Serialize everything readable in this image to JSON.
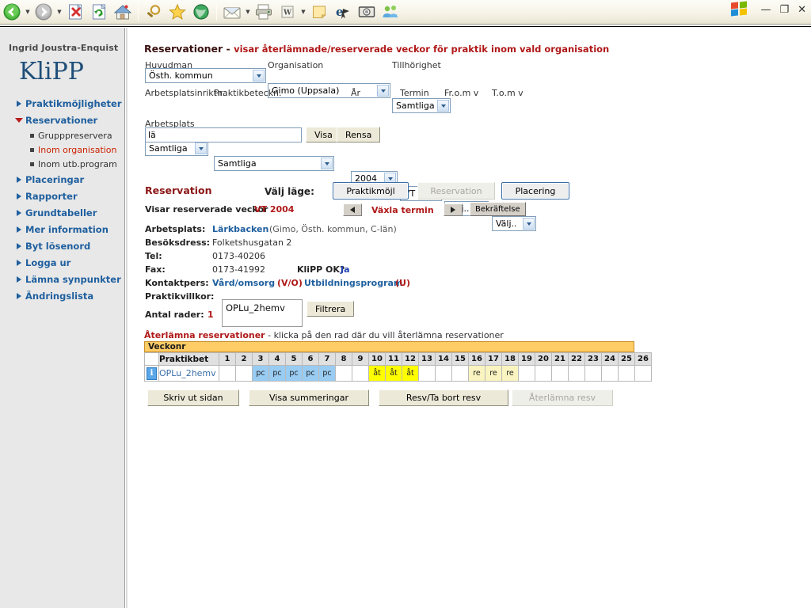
{
  "browser": {
    "toolbar_icons": [
      {
        "name": "back-icon",
        "glyph": "◀"
      },
      {
        "name": "back-dropdown-caret",
        "glyph": "▼"
      },
      {
        "name": "forward-icon",
        "glyph": "▶"
      },
      {
        "name": "forward-dropdown-caret",
        "glyph": "▼"
      },
      {
        "name": "stop-icon",
        "glyph": "✖"
      },
      {
        "name": "refresh-icon",
        "glyph": "⟳"
      },
      {
        "name": "home-icon",
        "glyph": "⌂"
      },
      {
        "name": "search-icon",
        "glyph": "🔍"
      },
      {
        "name": "favorites-star-icon",
        "glyph": "★"
      },
      {
        "name": "history-icon",
        "glyph": "🕘"
      },
      {
        "name": "mail-icon",
        "glyph": "✉"
      },
      {
        "name": "mail-dropdown-caret",
        "glyph": "▼"
      },
      {
        "name": "print-icon",
        "glyph": "🖨"
      },
      {
        "name": "edit-word-icon",
        "glyph": "W"
      },
      {
        "name": "edit-dropdown-caret",
        "glyph": "▼"
      },
      {
        "name": "notes-icon",
        "glyph": "▭"
      },
      {
        "name": "messenger-e-icon",
        "glyph": "e"
      },
      {
        "name": "camera-icon",
        "glyph": "▣"
      },
      {
        "name": "people-icon",
        "glyph": "👥"
      }
    ],
    "window_controls": {
      "minimize": "—",
      "restore": "❐",
      "close": "✕"
    }
  },
  "sidebar": {
    "user": "Ingrid Joustra-Enquist",
    "brand": "KliPP",
    "items": [
      {
        "label": "Praktikmöjligheter",
        "state": "collapsed"
      },
      {
        "label": "Reservationer",
        "state": "expanded"
      },
      {
        "label": "Placeringar",
        "state": "collapsed"
      },
      {
        "label": "Rapporter",
        "state": "collapsed"
      },
      {
        "label": "Grundtabeller",
        "state": "collapsed"
      },
      {
        "label": "Mer information",
        "state": "collapsed"
      },
      {
        "label": "Byt lösenord",
        "state": "collapsed"
      },
      {
        "label": "Logga ur",
        "state": "collapsed"
      },
      {
        "label": "Lämna synpunkter",
        "state": "collapsed"
      },
      {
        "label": "Ändringslista",
        "state": "collapsed"
      }
    ],
    "subitems": [
      {
        "label": "Grupppreservera",
        "active": false
      },
      {
        "label": "Inom organisation",
        "active": true
      },
      {
        "label": "Inom utb.program",
        "active": false
      }
    ]
  },
  "page": {
    "title": "Reservationer",
    "title_separator": " - ",
    "subtitle": "visar återlämnade/reserverade veckor för praktik inom vald organisation"
  },
  "filters": {
    "huvudman": {
      "label": "Huvudman",
      "value": "Östh. kommun"
    },
    "organisation": {
      "label": "Organisation",
      "value": "Gimo (Uppsala)"
    },
    "tillhorighet": {
      "label": "Tillhörighet",
      "value": "Samtliga"
    },
    "arbetsplatsinriktn": {
      "label": "Arbetsplatsinriktn.",
      "value": "Samtliga"
    },
    "praktikbeteckn": {
      "label": "Praktikbeteckn.",
      "value": "Samtliga"
    },
    "ar": {
      "label": "År",
      "value": "2004"
    },
    "termin": {
      "label": "Termin",
      "value": "VT"
    },
    "fr_o_m_v": {
      "label": "Fr.o.m v",
      "value": "Välj.."
    },
    "t_o_m_v": {
      "label": "T.o.m v",
      "value": "Välj.."
    },
    "arbetsplats": {
      "label": "Arbetsplats",
      "value": "lä",
      "placeholder": ""
    },
    "visa_button": "Visa",
    "rensa_button": "Rensa"
  },
  "reservation": {
    "heading": "Reservation",
    "mode_label": "Välj läge:",
    "mode_buttons": [
      {
        "label": "Praktikmöjl",
        "state": "active"
      },
      {
        "label": "Reservation",
        "state": "disabled"
      },
      {
        "label": "Placering",
        "state": "active"
      }
    ],
    "showing_label": "Visar reserverade veckor",
    "showing_value": "VT 2004",
    "term_switch_label": "Växla termin",
    "prev_arrow": "◀",
    "next_arrow": "▶",
    "confirm_button": "Bekräftelse",
    "details": [
      {
        "label": "Arbetsplats:",
        "value": "Lärkbacken",
        "extra": "(Gimo, Östh. kommun, C-län)"
      },
      {
        "label": "Besöksdress:",
        "value": "Folketshusgatan 2",
        "extra": ""
      },
      {
        "label": "Tel:",
        "value": "0173-40206",
        "extra": ""
      },
      {
        "label": "Fax:",
        "value": "0173-41992",
        "extra": ""
      },
      {
        "label": "Kontaktpers:",
        "value": "",
        "extra": ""
      },
      {
        "label": "Praktikvillkor:",
        "value": "",
        "extra": ""
      }
    ],
    "klipp_ok_label": "KliPP OK?",
    "klipp_ok_value": "Ja",
    "contact_1_name": "Vård/omsorg",
    "contact_1_code": "(V/O)",
    "contact_2_name": "Utbildningsprogram",
    "contact_2_code": "(U)",
    "antal_rader_label": "Antal rader:",
    "antal_rader_value": "1",
    "filter_textarea_value": "OPLu_2hemv",
    "filtrera_button": "Filtrera"
  },
  "table_note": {
    "bold": "Återlämna reservationer",
    "rest": " - klicka på den rad där du vill återlämna reservationer"
  },
  "week_table": {
    "band_label": "Veckonr",
    "col_label": "Praktikbet",
    "weeks": [
      "1",
      "2",
      "3",
      "4",
      "5",
      "6",
      "7",
      "8",
      "9",
      "10",
      "11",
      "12",
      "13",
      "14",
      "15",
      "16",
      "17",
      "18",
      "19",
      "20",
      "21",
      "22",
      "23",
      "24",
      "25",
      "26"
    ],
    "rows": [
      {
        "info_icon": "i",
        "name": "OPLu_2hemv",
        "cells": [
          "",
          "",
          "pc",
          "pc",
          "pc",
          "pc",
          "pc",
          "",
          "",
          "åt",
          "åt",
          "åt",
          "",
          "",
          "",
          "re",
          "re",
          "re",
          "",
          "",
          "",
          "",
          "",
          "",
          "",
          ""
        ],
        "cell_types": [
          "",
          "",
          "pc",
          "pc",
          "pc",
          "pc",
          "pc",
          "",
          "",
          "at",
          "at",
          "at",
          "",
          "",
          "",
          "re",
          "re",
          "re",
          "",
          "",
          "",
          "",
          "",
          "",
          "",
          ""
        ]
      }
    ]
  },
  "bottom_buttons": [
    {
      "label": "Skriv ut sidan",
      "state": "enabled"
    },
    {
      "label": "Visa summeringar",
      "state": "enabled"
    },
    {
      "label": "Resv/Ta bort resv",
      "state": "enabled"
    },
    {
      "label": "Återlämna resv",
      "state": "disabled"
    }
  ],
  "colors": {
    "brand_blue": "#1f5f9e",
    "accent_red": "#b01818",
    "band_orange": "#ffcc66",
    "pc_blue": "#99ccf2",
    "at_yellow": "#ffff00",
    "re_yellow": "#faf4c0"
  }
}
